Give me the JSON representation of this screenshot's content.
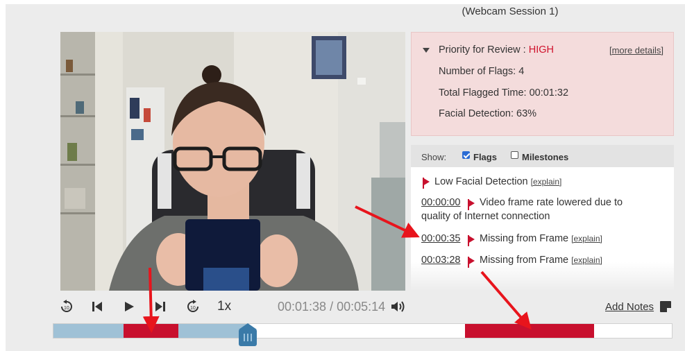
{
  "session_title": "(Webcam Session 1)",
  "priority": {
    "label": "Priority for Review : ",
    "level": "HIGH",
    "more_link": "[more details]",
    "flags_count": "Number of Flags: 4",
    "flagged_time": "Total Flagged Time: 00:01:32",
    "facial_detection": "Facial Detection: 63%"
  },
  "show": {
    "label": "Show:",
    "flags_label": "Flags",
    "flags_checked": true,
    "milestones_label": "Milestones",
    "milestones_checked": false
  },
  "flags": [
    {
      "time": "",
      "text": "Low Facial Detection",
      "explain": "[explain]"
    },
    {
      "time": "00:00:00",
      "text": "Video frame rate lowered due to",
      "text2": "quality of Internet connection",
      "explain": ""
    },
    {
      "time": "00:00:35",
      "text": "Missing from Frame",
      "explain": "[explain]"
    },
    {
      "time": "00:03:28",
      "text": "Missing from Frame",
      "explain": "[explain]"
    }
  ],
  "controls": {
    "rewind": "rewind-10-icon",
    "prev": "skip-back-icon",
    "play": "play-icon",
    "next": "skip-forward-icon",
    "forward": "forward-10-icon",
    "speed": "1x",
    "time": "00:01:38 / 00:05:14",
    "volume": "volume-icon",
    "add_notes": "Add Notes"
  },
  "timeline": {
    "progress_fraction": 0.313,
    "flag_color": "#c8102e",
    "watched_color": "#9fc1d6"
  }
}
